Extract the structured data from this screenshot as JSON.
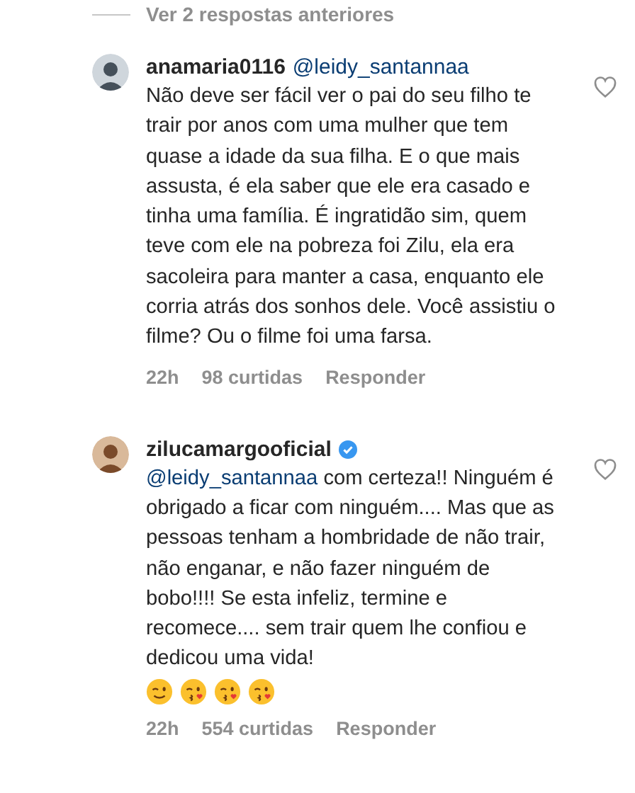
{
  "previous_replies": {
    "label": "Ver 2 respostas anteriores"
  },
  "comments": [
    {
      "username": "anamaria0116",
      "header_mention": "@leidy_santannaa",
      "body": "Não deve ser fácil ver o pai do seu filho te trair por anos com uma mulher que tem quase a idade da sua filha. E o que mais assusta, é ela saber que ele era casado e tinha uma família. É ingratidão sim, quem teve com ele na pobreza foi Zilu, ela era sacoleira para manter a casa, enquanto ele corria atrás dos sonhos dele. Você assistiu o filme? Ou o filme foi uma farsa.",
      "liked": false,
      "time": "22h",
      "likes": "98 curtidas",
      "reply": "Responder"
    },
    {
      "username": "zilucamargooficial",
      "verified": true,
      "body_mention": "@leidy_santannaa",
      "body": "com certeza!! Ninguém é obrigado a ficar com ninguém.... Mas que as pessoas tenham a hombridade de não trair, não enganar, e não fazer ninguém de bobo!!!! Se esta infeliz, termine e recomece.... sem trair quem lhe confiou e dedicou uma vida!",
      "emojis": [
        {
          "kind": "wink"
        },
        {
          "kind": "kiss"
        },
        {
          "kind": "kiss"
        },
        {
          "kind": "kiss"
        }
      ],
      "liked": false,
      "time": "22h",
      "likes": "554 curtidas",
      "reply": "Responder"
    }
  ]
}
